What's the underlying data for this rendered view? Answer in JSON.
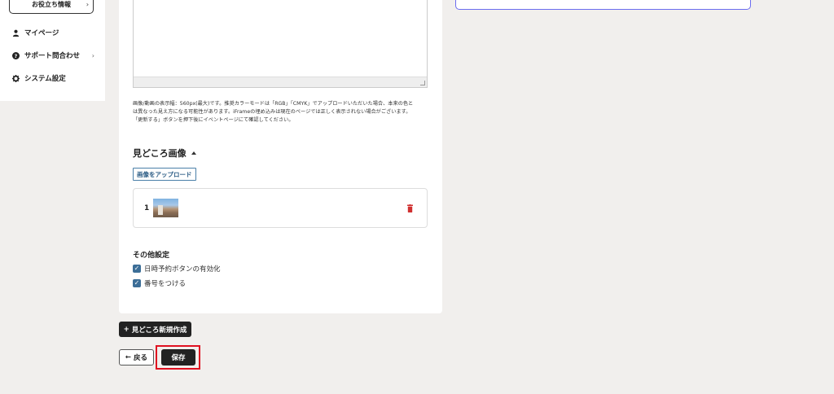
{
  "sidebar": {
    "info_label": "お役立ち情報",
    "items": [
      {
        "label": "マイページ",
        "icon": "user-icon"
      },
      {
        "label": "サポート問合わせ",
        "icon": "question-circle-icon"
      },
      {
        "label": "システム設定",
        "icon": "gear-icon"
      }
    ]
  },
  "editor": {
    "note_lines": [
      "画像/動画の表示幅：560px(最大)です。推奨カラーモードは「RGB」「CMYK」でアップロードいただいた場合、本来の色と",
      "は異なった見え方になる可能性があります。iFrameの埋め込みは現在のページでは正しく表示されない場合がございます。",
      "「更新する」ボタンを押下後にイベントページにて確認してください。"
    ]
  },
  "highlights": {
    "title": "見どころ画像",
    "upload_label": "画像をアップロード",
    "images": [
      {
        "number": "1"
      }
    ]
  },
  "other_settings": {
    "title": "その他設定",
    "options": [
      {
        "label": "日時予約ボタンの有効化",
        "checked": true
      },
      {
        "label": "番号をつける",
        "checked": true
      }
    ]
  },
  "actions": {
    "new_label": "見どころ新規作成",
    "back_label": "戻る",
    "save_label": "保存"
  },
  "colors": {
    "accent": "#3c6e97",
    "delete": "#d03030",
    "highlight": "#e01020",
    "focus_border": "#6b6cf0"
  }
}
